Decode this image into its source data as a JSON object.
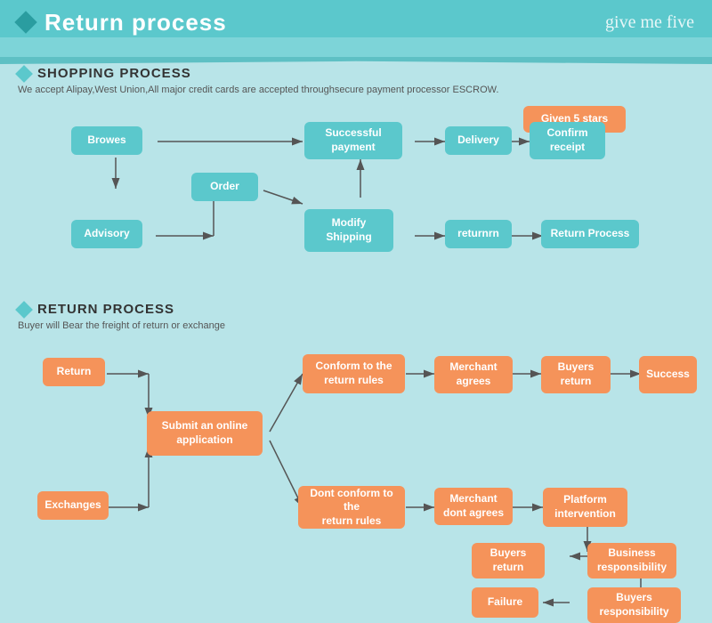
{
  "header": {
    "title": "Return process",
    "logo": "give me five"
  },
  "shopping": {
    "section_title": "SHOPPING PROCESS",
    "subtitle": "We accept Alipay,West Union,All major credit cards are accepted throughsecure payment processor ESCROW.",
    "boxes": [
      {
        "id": "browes",
        "label": "Browes",
        "type": "teal"
      },
      {
        "id": "order",
        "label": "Order",
        "type": "teal"
      },
      {
        "id": "advisory",
        "label": "Advisory",
        "type": "teal"
      },
      {
        "id": "modify-shipping",
        "label": "Modify\nShipping",
        "type": "teal"
      },
      {
        "id": "successful-payment",
        "label": "Successful\npayment",
        "type": "teal"
      },
      {
        "id": "delivery",
        "label": "Delivery",
        "type": "teal"
      },
      {
        "id": "confirm-receipt",
        "label": "Confirm\nreceipt",
        "type": "teal"
      },
      {
        "id": "given-5-stars",
        "label": "Given 5 stars",
        "type": "orange"
      },
      {
        "id": "returnrn",
        "label": "returnrn",
        "type": "teal"
      },
      {
        "id": "return-process",
        "label": "Return Process",
        "type": "teal"
      }
    ]
  },
  "return_section": {
    "section_title": "RETURN PROCESS",
    "subtitle": "Buyer will Bear the freight of return or exchange",
    "boxes": [
      {
        "id": "return-btn",
        "label": "Return",
        "type": "orange"
      },
      {
        "id": "exchanges-btn",
        "label": "Exchanges",
        "type": "orange"
      },
      {
        "id": "submit-online",
        "label": "Submit an online\napplication",
        "type": "orange"
      },
      {
        "id": "conform-return-rules",
        "label": "Conform to the\nreturn rules",
        "type": "orange"
      },
      {
        "id": "dont-conform",
        "label": "Dont conform to the\nreturn rules",
        "type": "orange"
      },
      {
        "id": "merchant-agrees",
        "label": "Merchant\nagrees",
        "type": "orange"
      },
      {
        "id": "merchant-dont-agrees",
        "label": "Merchant\ndont agrees",
        "type": "orange"
      },
      {
        "id": "buyers-return-1",
        "label": "Buyers\nreturn",
        "type": "orange"
      },
      {
        "id": "platform-intervention",
        "label": "Platform\nintervention",
        "type": "orange"
      },
      {
        "id": "buyers-return-2",
        "label": "Buyers\nreturn",
        "type": "orange"
      },
      {
        "id": "business-responsibility",
        "label": "Business\nresponsibility",
        "type": "orange"
      },
      {
        "id": "success",
        "label": "Success",
        "type": "orange"
      },
      {
        "id": "failure",
        "label": "Failure",
        "type": "orange"
      },
      {
        "id": "buyers-responsibility",
        "label": "Buyers\nresponsibility",
        "type": "orange"
      }
    ]
  }
}
